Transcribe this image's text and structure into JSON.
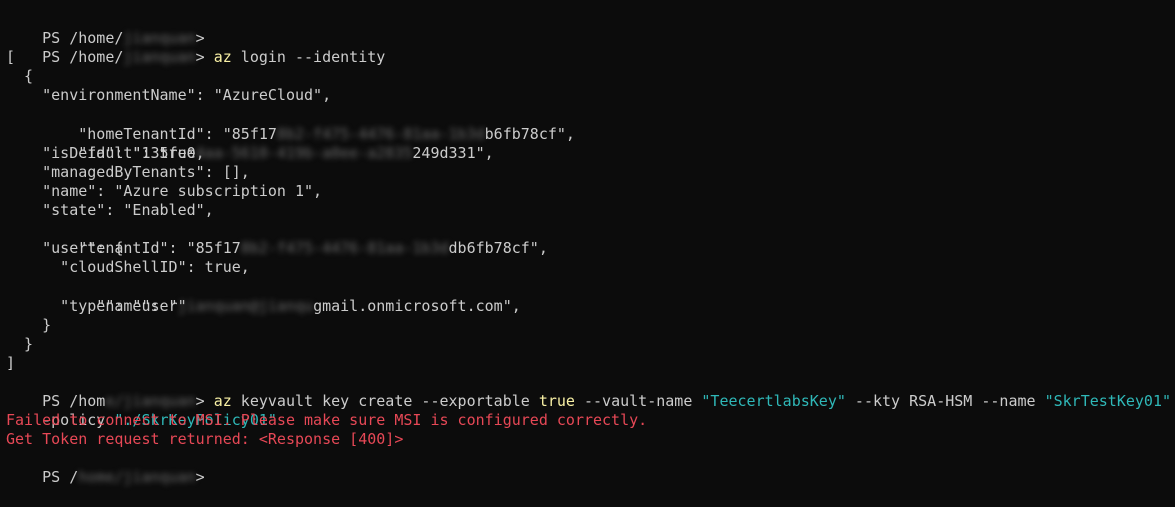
{
  "terminal": {
    "colors": {
      "background": "#0c0c0c",
      "foreground": "#cccccc",
      "command": "#f9f1a5",
      "string": "#2fb8b8",
      "error": "#e74856"
    },
    "top_partial": "                              ",
    "prompt_prefix": "PS /home/",
    "prompt_prefix_short": "PS /hom",
    "prompt_prefix_tiny": "PS /",
    "prompt_suffix": "> ",
    "prompt_end": ">",
    "user_masked": "jianquan",
    "user_masked_1": "jianquan",
    "user_masked_2": "e/jianquan",
    "user_masked_3": "home/jianquan",
    "login_cmd": "az",
    "login_args": " login --identity",
    "json": {
      "open_bracket": "[",
      "open_brace": "  {",
      "env_line": "    \"environmentName\": \"AzureCloud\",",
      "home_tenant_prefix": "    \"homeTenantId\": \"85f17",
      "home_tenant_masked": "8b2-f475-4476-81aa-1b3d",
      "home_tenant_suffix": "b6fb78cf\",",
      "id_prefix": "    \"id\": \"135fe0",
      "id_masked": "4aa-5610-419b-a0ee-a2835",
      "id_suffix": "249d331\",",
      "is_default": "    \"isDefault\": true,",
      "managed": "    \"managedByTenants\": [],",
      "name_line": "    \"name\": \"Azure subscription 1\",",
      "state_line": "    \"state\": \"Enabled\",",
      "tenant_prefix": "    \"tenantId\": \"85f17",
      "tenant_masked": "8b2-f475-4476-81aa-1b3d",
      "tenant_suffix": "db6fb78cf\",",
      "user_open": "    \"user\": {",
      "cloud_shell": "      \"cloudShellID\": true,",
      "user_name_prefix": "      \"name\": \"",
      "user_name_masked": "jianquan@jianqu",
      "user_name_suffix": "gmail.onmicrosoft.com\",",
      "user_type": "      \"type\": \"user\"",
      "user_close": "    }",
      "close_brace": "  }",
      "close_bracket": "]"
    },
    "kv_cmd": "az",
    "kv_part1": " keyvault key create --exportable ",
    "kv_true": "true",
    "kv_part2": " --vault-name ",
    "kv_vault": "\"TeecertlabsKey\"",
    "kv_part3": " --kty RSA-HSM --name ",
    "kv_keyname": "\"SkrTestKey01\"",
    "kv_part4": " -",
    "kv_cont": "-policy ",
    "kv_policy": "\"./SkrKeyPolicy01\"",
    "error1": "Failed to connect to MSI. Please make sure MSI is configured correctly.",
    "error2": "Get Token request returned: <Response [400]>"
  }
}
